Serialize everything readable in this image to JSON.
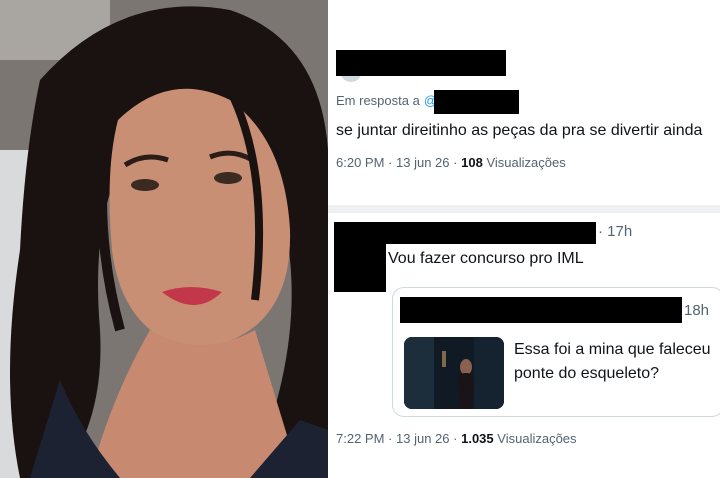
{
  "tweet1": {
    "reply_prefix": "Em resposta a",
    "handle_prefix": "@",
    "text": "se juntar direitinho as peças da pra se divertir ainda",
    "time": "6:20 PM",
    "date": "13 jun 26",
    "views_count": "108",
    "views_label": "Visualizações"
  },
  "tweet2": {
    "handle_suffix": "·",
    "time_ago": "17h",
    "text": "Vou fazer concurso pro IML",
    "time": "7:22 PM",
    "date": "13 jun 26",
    "views_count": "1.035",
    "views_label": "Visualizações"
  },
  "quoted": {
    "time_ago": "18h",
    "text_line1": "Essa foi a mina que faleceu",
    "text_line2": "ponte do esqueleto?"
  },
  "separator": "·"
}
